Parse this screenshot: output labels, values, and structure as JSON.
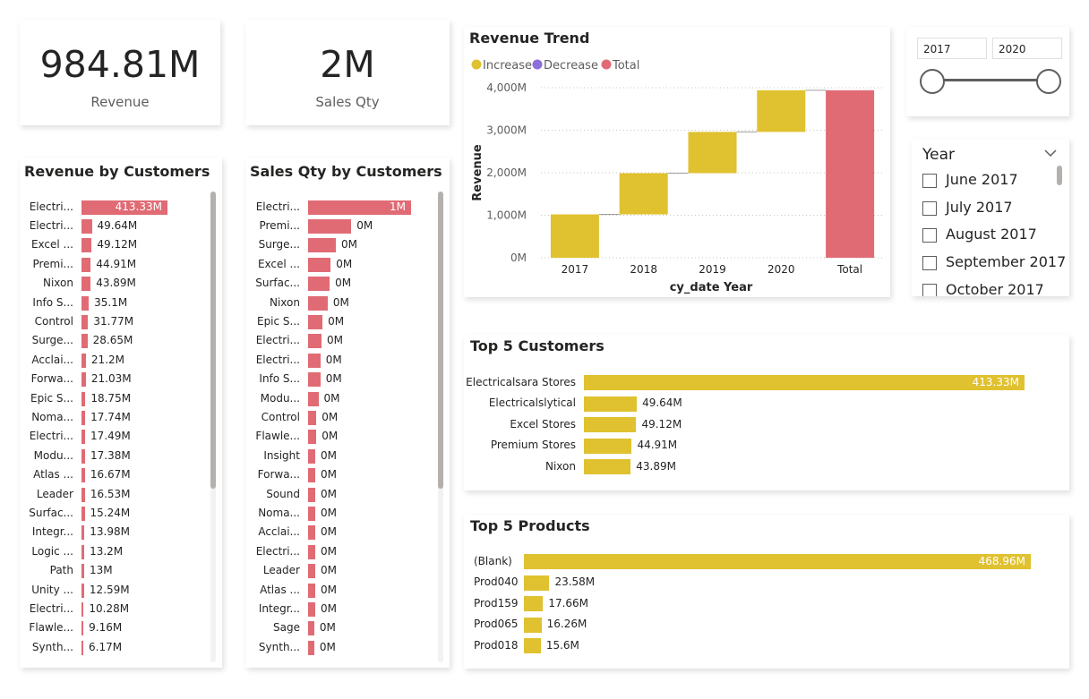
{
  "colors": {
    "increase": "#E0C12F",
    "decrease": "#8C6FD9",
    "total": "#E06B74",
    "bar_pink": "#E06B74",
    "bar_gold": "#E0C12F"
  },
  "kpi_revenue": {
    "value": "984.81M",
    "label": "Revenue"
  },
  "kpi_sales_qty": {
    "value": "2M",
    "label": "Sales Qty"
  },
  "revenue_by_customers": {
    "title": "Revenue by Customers",
    "rows": [
      {
        "label": "Electri...",
        "value": 413.33,
        "text": "413.33M"
      },
      {
        "label": "Electri...",
        "value": 49.64,
        "text": "49.64M"
      },
      {
        "label": "Excel ...",
        "value": 49.12,
        "text": "49.12M"
      },
      {
        "label": "Premi...",
        "value": 44.91,
        "text": "44.91M"
      },
      {
        "label": "Nixon",
        "value": 43.89,
        "text": "43.89M"
      },
      {
        "label": "Info S...",
        "value": 35.1,
        "text": "35.1M"
      },
      {
        "label": "Control",
        "value": 31.77,
        "text": "31.77M"
      },
      {
        "label": "Surge...",
        "value": 28.65,
        "text": "28.65M"
      },
      {
        "label": "Acclai...",
        "value": 21.2,
        "text": "21.2M"
      },
      {
        "label": "Forwa...",
        "value": 21.03,
        "text": "21.03M"
      },
      {
        "label": "Epic S...",
        "value": 18.75,
        "text": "18.75M"
      },
      {
        "label": "Noma...",
        "value": 17.74,
        "text": "17.74M"
      },
      {
        "label": "Electri...",
        "value": 17.49,
        "text": "17.49M"
      },
      {
        "label": "Modu...",
        "value": 17.38,
        "text": "17.38M"
      },
      {
        "label": "Atlas ...",
        "value": 16.67,
        "text": "16.67M"
      },
      {
        "label": "Leader",
        "value": 16.53,
        "text": "16.53M"
      },
      {
        "label": "Surfac...",
        "value": 15.24,
        "text": "15.24M"
      },
      {
        "label": "Integr...",
        "value": 13.98,
        "text": "13.98M"
      },
      {
        "label": "Logic ...",
        "value": 13.2,
        "text": "13.2M"
      },
      {
        "label": "Path",
        "value": 13.0,
        "text": "13M"
      },
      {
        "label": "Unity ...",
        "value": 12.59,
        "text": "12.59M"
      },
      {
        "label": "Electri...",
        "value": 10.28,
        "text": "10.28M"
      },
      {
        "label": "Flawle...",
        "value": 9.16,
        "text": "9.16M"
      },
      {
        "label": "Synth...",
        "value": 6.17,
        "text": "6.17M"
      }
    ]
  },
  "sales_qty_by_customers": {
    "title": "Sales Qty by Customers",
    "rows": [
      {
        "label": "Electri...",
        "value": 1.0,
        "text": "1M"
      },
      {
        "label": "Premi...",
        "value": 0.42,
        "text": "0M"
      },
      {
        "label": "Surge...",
        "value": 0.27,
        "text": "0M"
      },
      {
        "label": "Excel ...",
        "value": 0.22,
        "text": "0M"
      },
      {
        "label": "Surfac...",
        "value": 0.21,
        "text": "0M"
      },
      {
        "label": "Nixon",
        "value": 0.19,
        "text": "0M"
      },
      {
        "label": "Epic S...",
        "value": 0.14,
        "text": "0M"
      },
      {
        "label": "Electri...",
        "value": 0.13,
        "text": "0M"
      },
      {
        "label": "Electri...",
        "value": 0.12,
        "text": "0M"
      },
      {
        "label": "Info S...",
        "value": 0.12,
        "text": "0M"
      },
      {
        "label": "Modu...",
        "value": 0.1,
        "text": "0M"
      },
      {
        "label": "Control",
        "value": 0.08,
        "text": "0M"
      },
      {
        "label": "Flawle...",
        "value": 0.08,
        "text": "0M"
      },
      {
        "label": "Insight",
        "value": 0.07,
        "text": "0M"
      },
      {
        "label": "Forwa...",
        "value": 0.07,
        "text": "0M"
      },
      {
        "label": "Sound",
        "value": 0.07,
        "text": "0M"
      },
      {
        "label": "Noma...",
        "value": 0.07,
        "text": "0M"
      },
      {
        "label": "Acclai...",
        "value": 0.07,
        "text": "0M"
      },
      {
        "label": "Electri...",
        "value": 0.07,
        "text": "0M"
      },
      {
        "label": "Leader",
        "value": 0.07,
        "text": "0M"
      },
      {
        "label": "Atlas ...",
        "value": 0.07,
        "text": "0M"
      },
      {
        "label": "Integr...",
        "value": 0.07,
        "text": "0M"
      },
      {
        "label": "Sage",
        "value": 0.06,
        "text": "0M"
      },
      {
        "label": "Synth...",
        "value": 0.06,
        "text": "0M"
      }
    ]
  },
  "year_slider": {
    "start": "2017",
    "end": "2020"
  },
  "year_slicer": {
    "title": "Year",
    "items": [
      "June 2017",
      "July 2017",
      "August 2017",
      "September 2017",
      "October 2017"
    ]
  },
  "chart_data": [
    {
      "type": "bar",
      "subtype": "waterfall",
      "title": "Revenue Trend",
      "legend": [
        "Increase",
        "Decrease",
        "Total"
      ],
      "legend_position": "top-left",
      "categories": [
        "2017",
        "2018",
        "2019",
        "2020",
        "Total"
      ],
      "series": [
        {
          "name": "Increase",
          "values": [
            1020,
            970,
            970,
            980,
            null
          ]
        },
        {
          "name": "Total",
          "values": [
            null,
            null,
            null,
            null,
            3940
          ]
        }
      ],
      "xlabel": "cy_date Year",
      "ylabel": "Revenue",
      "yticks": [
        "0M",
        "1,000M",
        "2,000M",
        "3,000M",
        "4,000M"
      ],
      "ylim": [
        0,
        4000
      ],
      "grid": true
    },
    {
      "type": "bar",
      "orientation": "horizontal",
      "title": "Top 5 Customers",
      "categories": [
        "Electricalsara Stores",
        "Electricalslytical",
        "Excel Stores",
        "Premium Stores",
        "Nixon"
      ],
      "values": [
        413.33,
        49.64,
        49.12,
        44.91,
        43.89
      ],
      "value_labels": [
        "413.33M",
        "49.64M",
        "49.12M",
        "44.91M",
        "43.89M"
      ]
    },
    {
      "type": "bar",
      "orientation": "horizontal",
      "title": "Top 5 Products",
      "categories": [
        "(Blank)",
        "Prod040",
        "Prod159",
        "Prod065",
        "Prod018"
      ],
      "values": [
        468.96,
        23.58,
        17.66,
        16.26,
        15.6
      ],
      "value_labels": [
        "468.96M",
        "23.58M",
        "17.66M",
        "16.26M",
        "15.6M"
      ]
    }
  ]
}
